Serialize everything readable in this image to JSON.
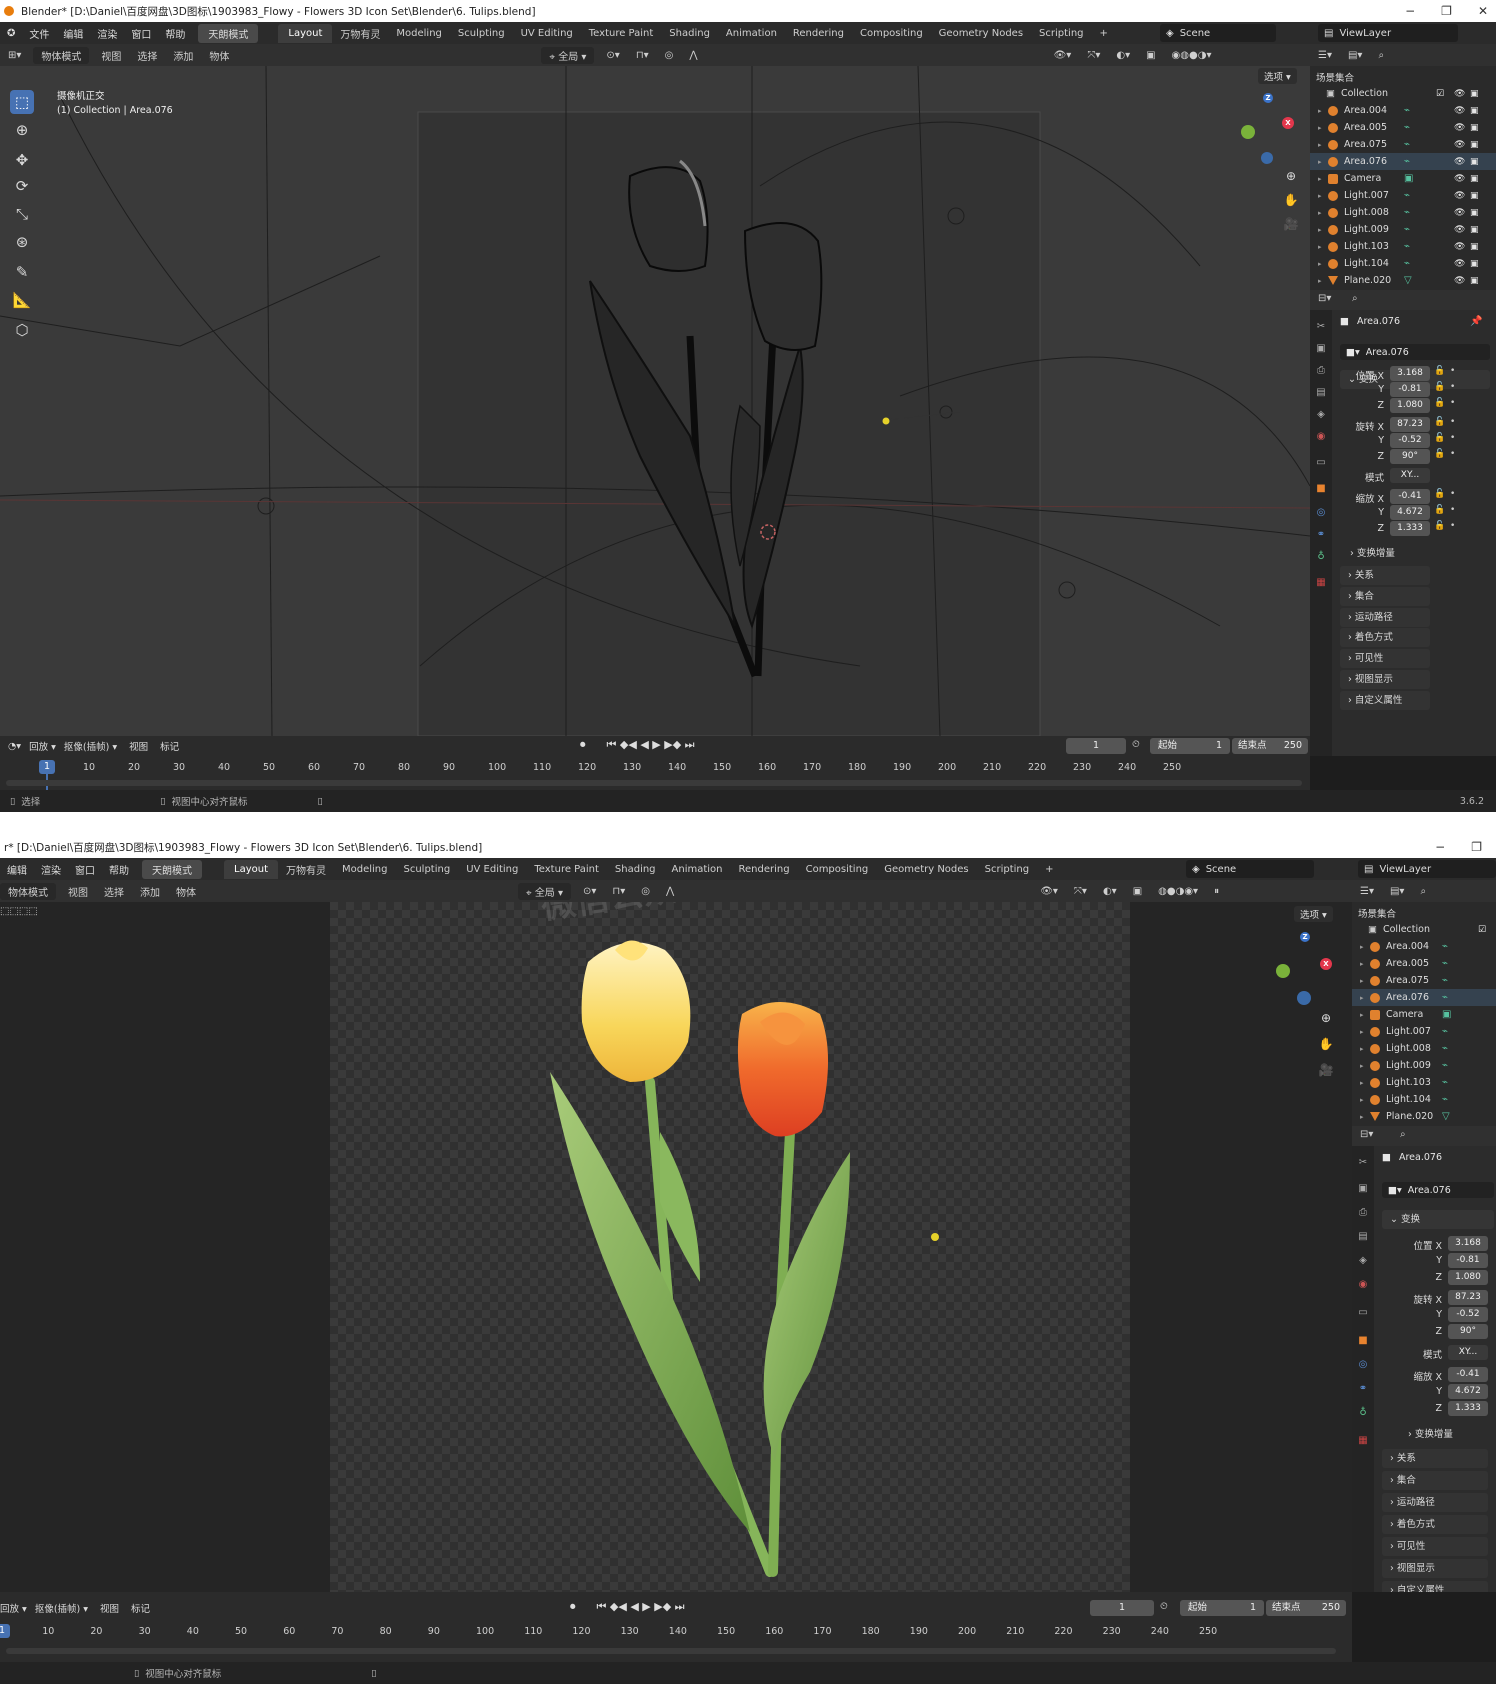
{
  "title": "Blender* [D:\\Daniel\\百度网盘\\3D图标\\1903983_Flowy - Flowers 3D Icon Set\\Blender\\6. Tulips.blend]",
  "title2": "r* [D:\\Daniel\\百度网盘\\3D图标\\1903983_Flowy - Flowers 3D Icon Set\\Blender\\6. Tulips.blend]",
  "window_controls": {
    "minimize": "−",
    "maximize": "❐",
    "close": "✕"
  },
  "menu": [
    "文件",
    "编辑",
    "渲染",
    "窗口",
    "帮助"
  ],
  "menu2": [
    "编辑",
    "渲染",
    "窗口",
    "帮助"
  ],
  "mode_badge": "天朗模式",
  "workspaces": [
    "Layout",
    "万物有灵",
    "Modeling",
    "Sculpting",
    "UV Editing",
    "Texture Paint",
    "Shading",
    "Animation",
    "Rendering",
    "Compositing",
    "Geometry Nodes",
    "Scripting"
  ],
  "add_tab": "+",
  "scene": "Scene",
  "view_layer": "ViewLayer",
  "header": {
    "object_mode": "物体模式",
    "view": "视图",
    "select": "选择",
    "add": "添加",
    "object": "物体",
    "transform_orientation": "全局",
    "options": "选项"
  },
  "viewport": {
    "label_view": "摄像机正交",
    "label_collection": "(1) Collection | Area.076",
    "gizmo": {
      "z": "Z",
      "x": "X",
      "y": "Y"
    }
  },
  "outliner": {
    "title": "场景集合",
    "collection": "Collection",
    "items": [
      {
        "name": "Area.004",
        "type": "light"
      },
      {
        "name": "Area.005",
        "type": "light"
      },
      {
        "name": "Area.075",
        "type": "light"
      },
      {
        "name": "Area.076",
        "type": "light"
      },
      {
        "name": "Camera",
        "type": "camera"
      },
      {
        "name": "Light.007",
        "type": "light"
      },
      {
        "name": "Light.008",
        "type": "light"
      },
      {
        "name": "Light.009",
        "type": "light"
      },
      {
        "name": "Light.103",
        "type": "light"
      },
      {
        "name": "Light.104",
        "type": "light"
      },
      {
        "name": "Plane.020",
        "type": "mesh"
      }
    ]
  },
  "properties": {
    "object_name": "Area.076",
    "datablock": "Area.076",
    "transform_section": "变换",
    "location": {
      "label": "位置 X",
      "x": "3.168",
      "y": "-0.81",
      "z": "1.080"
    },
    "rotation": {
      "label": "旋转 X",
      "x": "87.23",
      "y": "-0.52",
      "z": "90°"
    },
    "mode_label": "模式",
    "mode_value": "XY...",
    "scale": {
      "label": "缩放 X",
      "x": "-0.41",
      "y": "4.672",
      "z": "1.333"
    },
    "axis_y": "Y",
    "axis_z": "Z",
    "delta": "变换增量",
    "sections": [
      "关系",
      "集合",
      "运动路径",
      "着色方式",
      "可见性",
      "视图显示",
      "自定义属性"
    ]
  },
  "timeline": {
    "playback": "回放",
    "keying": "抠像(插帧)",
    "view": "视图",
    "marker": "标记",
    "current_frame": "1",
    "start_label": "起始",
    "start": "1",
    "end_label": "结束点",
    "end": "250",
    "ticks": [
      "10",
      "20",
      "30",
      "40",
      "50",
      "60",
      "70",
      "80",
      "90",
      "100",
      "110",
      "120",
      "130",
      "140",
      "150",
      "160",
      "170",
      "180",
      "190",
      "200",
      "210",
      "220",
      "230",
      "240",
      "250"
    ],
    "playhead": "1"
  },
  "status": {
    "select": "选择",
    "center": "视图中心对齐鼠标",
    "version": "3.6.2"
  },
  "watermark": "微信公众号  资源汇",
  "colors": {
    "accent": "#4772b3",
    "light_icon": "#e0812e",
    "tulip_yellow": "#f5d24a",
    "tulip_orange": "#ee6a2a",
    "stem_green": "#7fae52"
  }
}
